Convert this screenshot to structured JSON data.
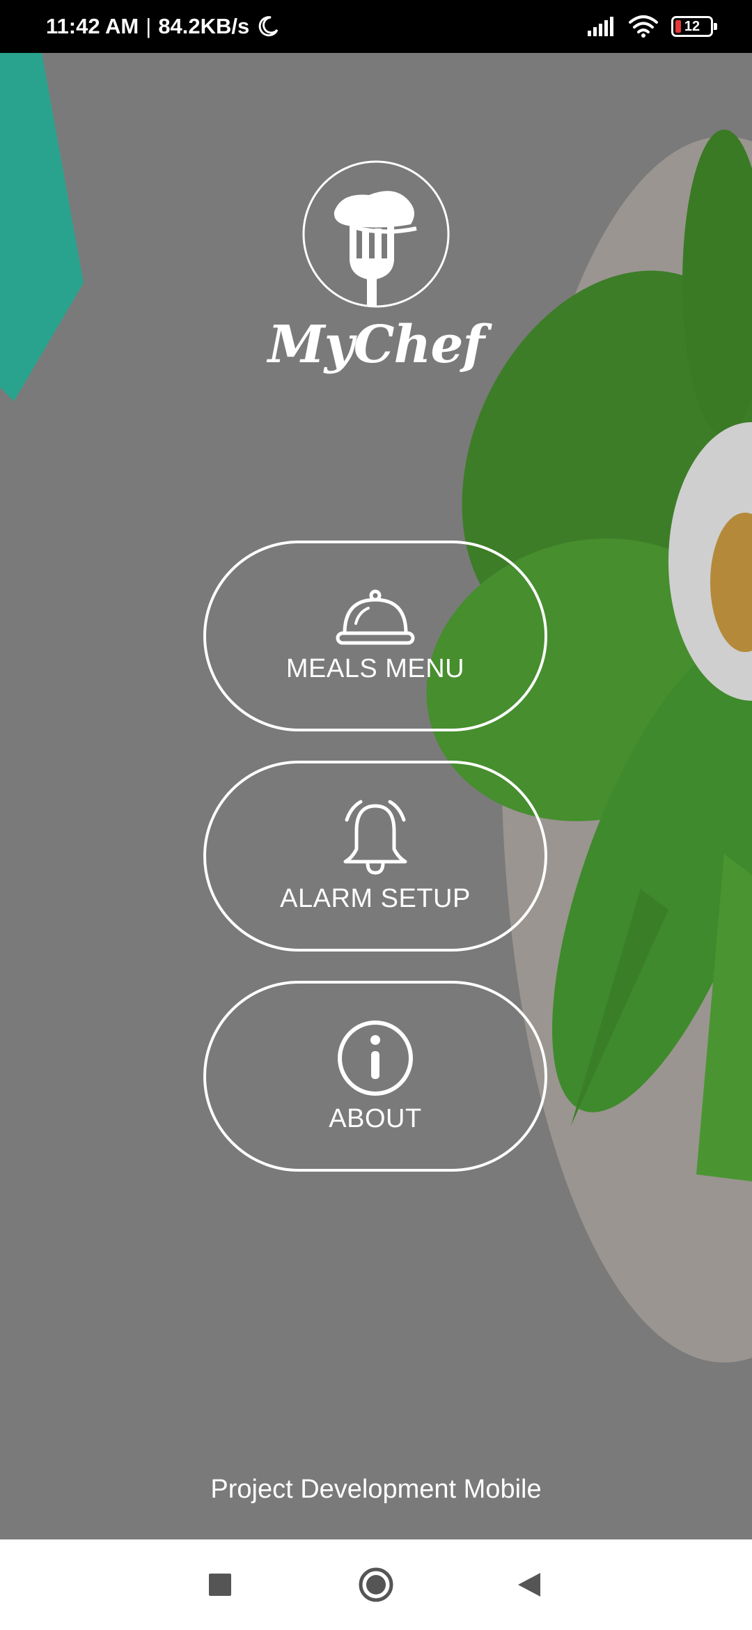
{
  "status_bar": {
    "time": "11:42 AM",
    "separator": "|",
    "network_speed": "84.2KB/s",
    "battery_level": "12",
    "icons": [
      "moon-icon",
      "signal-icon",
      "wifi-icon",
      "battery-icon"
    ]
  },
  "app": {
    "logo_text": "MyChef"
  },
  "menu": {
    "items": [
      {
        "label": "MEALS MENU",
        "icon": "cloche-icon"
      },
      {
        "label": "ALARM SETUP",
        "icon": "bell-icon"
      },
      {
        "label": "ABOUT",
        "icon": "info-icon"
      }
    ]
  },
  "footer": {
    "text": "Project Development Mobile"
  },
  "nav_bar": {
    "buttons": [
      "recents-square-icon",
      "home-circle-icon",
      "back-triangle-icon"
    ]
  },
  "colors": {
    "overlay": "#7a7a7a",
    "foreground": "#ffffff",
    "status_bar": "#000000",
    "nav_bar": "#ffffff",
    "leaf_green": "#3f8f2a",
    "tape_teal": "#1fa58c",
    "battery_low": "#e53935"
  }
}
